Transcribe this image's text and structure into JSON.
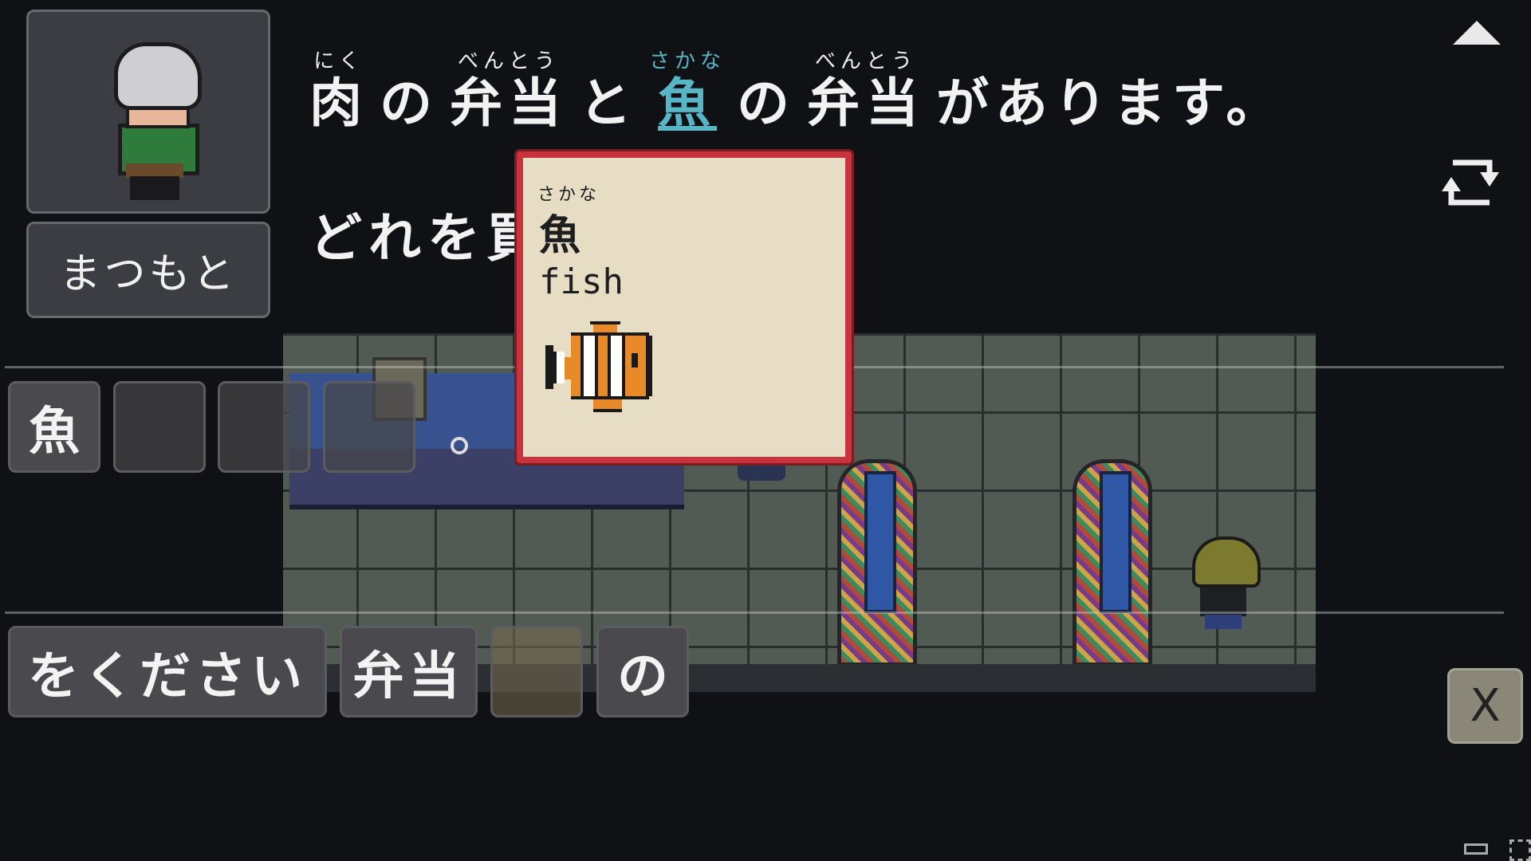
{
  "speaker": {
    "name": "まつもと"
  },
  "dialogue": {
    "line1": [
      {
        "ruby": "にく",
        "text": "肉",
        "highlight": false
      },
      {
        "ruby": "",
        "text": "の",
        "highlight": false
      },
      {
        "ruby": "べんとう",
        "text": "弁当",
        "highlight": false
      },
      {
        "ruby": "",
        "text": "と",
        "highlight": false
      },
      {
        "ruby": "さかな",
        "text": "魚",
        "highlight": true
      },
      {
        "ruby": "",
        "text": "の",
        "highlight": false
      },
      {
        "ruby": "べんとう",
        "text": "弁当",
        "highlight": false
      },
      {
        "ruby": "",
        "text": "があります。",
        "highlight": false
      }
    ],
    "line2": "どれを買"
  },
  "popup": {
    "ruby": "さかな",
    "word": "魚",
    "meaning": "fish",
    "icon": "clownfish-icon"
  },
  "answer_slots": [
    "魚",
    "",
    "",
    ""
  ],
  "word_choices": [
    "をください",
    "弁当",
    "",
    "の"
  ],
  "controls": {
    "close_label": "X"
  },
  "colors": {
    "highlight": "#58b5c6",
    "popup_border": "#c9333d",
    "popup_bg": "#e7dcc4"
  }
}
